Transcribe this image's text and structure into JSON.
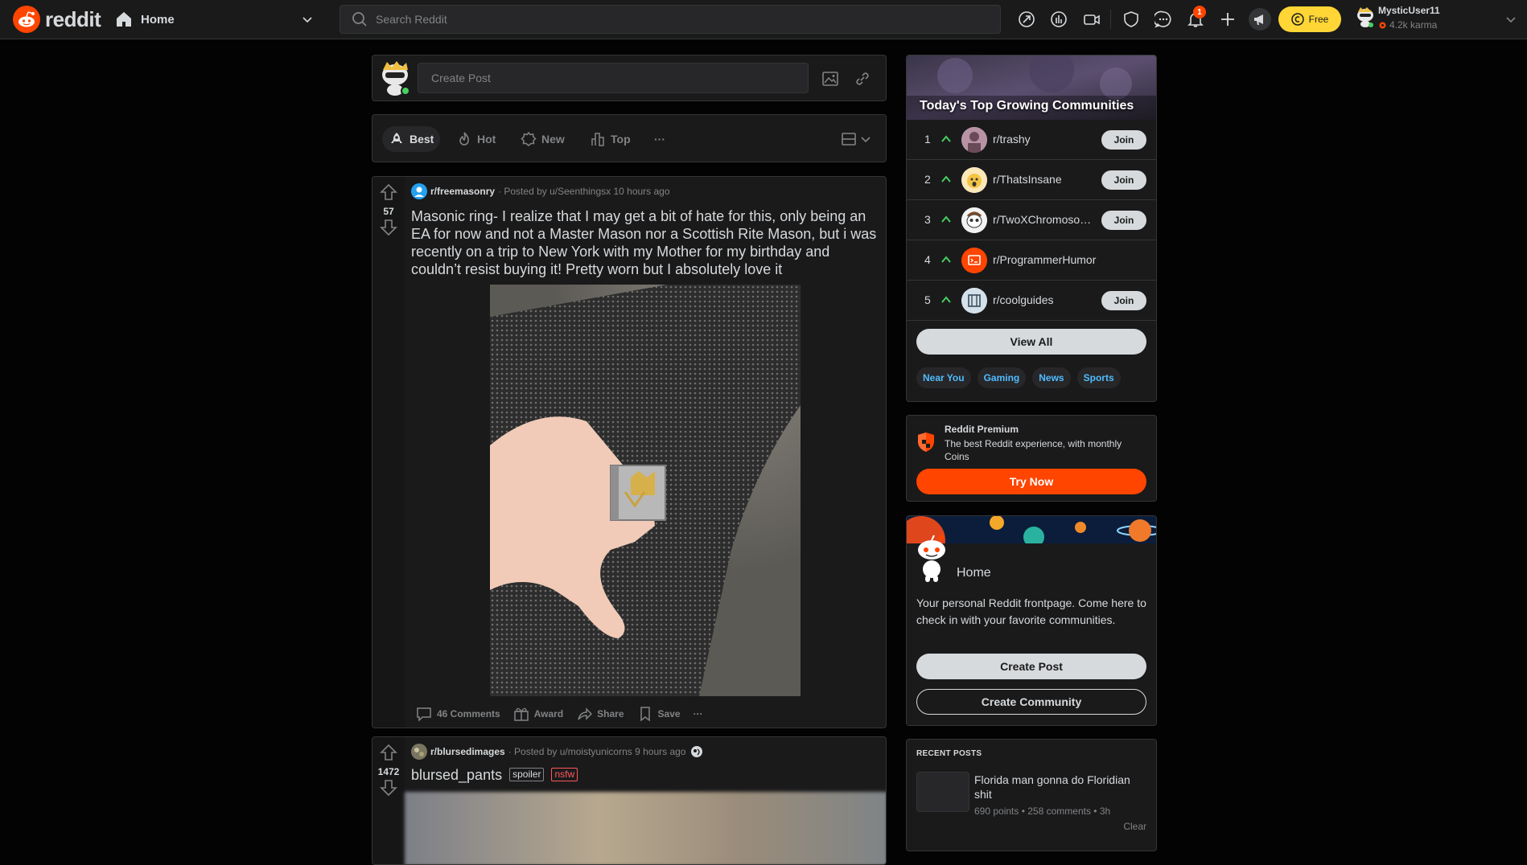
{
  "header": {
    "logo_text": "reddit",
    "home_label": "Home",
    "search_placeholder": "Search Reddit",
    "notification_count": "1",
    "free_label": "Free",
    "username": "MysticUser11",
    "karma": "4.2k karma"
  },
  "create_post": {
    "placeholder": "Create Post"
  },
  "sort": {
    "best": "Best",
    "hot": "Hot",
    "new": "New",
    "top": "Top",
    "more": "···"
  },
  "posts": [
    {
      "subreddit": "r/freemasonry",
      "posted_by": "· Posted by u/Seenthingsx 10 hours ago",
      "votes": "57",
      "title": "Masonic ring- I realize that I may get a bit of hate for this, only being an EA for now and not a Master Mason nor a Scottish Rite Mason, but i was recently on a trip to New York with my Mother for my birthday and couldn’t resist buying it! Pretty worn but I absolutely love it",
      "comments": "46 Comments",
      "award": "Award",
      "share": "Share",
      "save": "Save",
      "more": "···"
    },
    {
      "subreddit": "r/blursedimages",
      "posted_by": "· Posted by u/moistyunicorns 9 hours ago",
      "votes": "1472",
      "title": "blursed_pants",
      "tag_spoiler": "spoiler",
      "tag_nsfw": "nsfw"
    }
  ],
  "growing": {
    "title": "Today's Top Growing Communities",
    "communities": [
      {
        "rank": "1",
        "name": "r/trashy",
        "join": "Join"
      },
      {
        "rank": "2",
        "name": "r/ThatsInsane",
        "join": "Join"
      },
      {
        "rank": "3",
        "name": "r/TwoXChromosomes",
        "join": "Join"
      },
      {
        "rank": "4",
        "name": "r/ProgrammerHumor",
        "join": ""
      },
      {
        "rank": "5",
        "name": "r/coolguides",
        "join": "Join"
      }
    ],
    "view_all": "View All",
    "chips": [
      "Near You",
      "Gaming",
      "News",
      "Sports"
    ]
  },
  "premium": {
    "title": "Reddit Premium",
    "desc": "The best Reddit experience, with monthly Coins",
    "button": "Try Now"
  },
  "home_card": {
    "title": "Home",
    "desc": "Your personal Reddit frontpage. Come here to check in with your favorite communities.",
    "create_post": "Create Post",
    "create_community": "Create Community"
  },
  "recent": {
    "heading": "RECENT POSTS",
    "title": "Florida man gonna do Floridian shit",
    "meta": "690 points • 258 comments • 3h",
    "clear": "Clear"
  },
  "colors": {
    "accent": "#ff4500",
    "upvote_green": "#46d160",
    "link_blue": "#4fbcff",
    "premium_yellow": "#ffd635"
  }
}
